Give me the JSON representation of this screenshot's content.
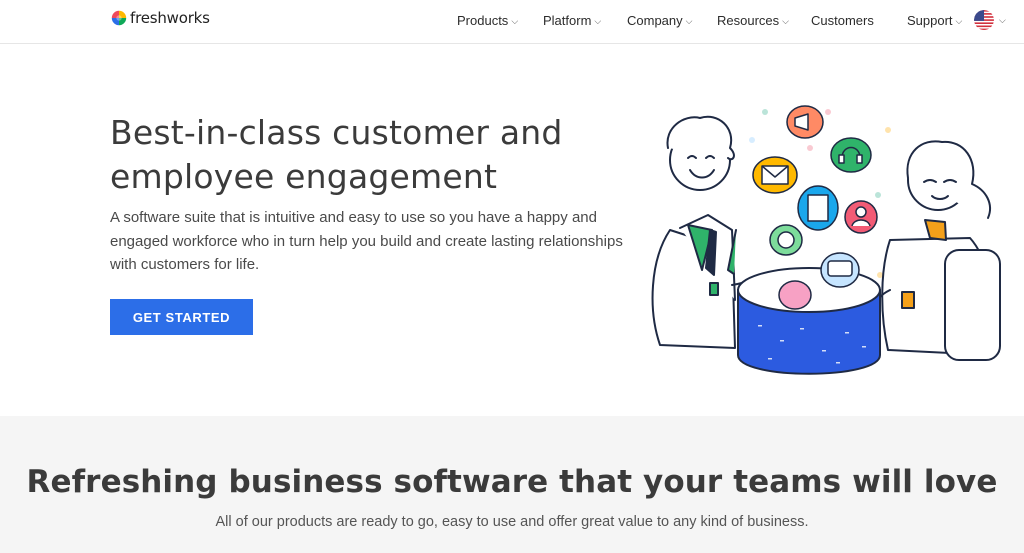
{
  "header": {
    "logo_text": "freshworks",
    "nav": [
      {
        "label": "Products",
        "has_dropdown": true
      },
      {
        "label": "Platform",
        "has_dropdown": true
      },
      {
        "label": "Company",
        "has_dropdown": true
      },
      {
        "label": "Resources",
        "has_dropdown": true
      },
      {
        "label": "Customers",
        "has_dropdown": false
      },
      {
        "label": "Support",
        "has_dropdown": true
      }
    ],
    "locale_icon": "us-flag-icon"
  },
  "hero": {
    "title": "Best-in-class customer and employee engagement",
    "subtitle": "A software suite that is intuitive and easy to use so you have a happy and engaged workforce who in turn help you build and create lasting relationships with customers for life.",
    "cta_label": "GET STARTED"
  },
  "section": {
    "title": "Refreshing business software that your teams will love",
    "subtitle": "All of our products are ready to go, easy to use and offer great value to any kind of business."
  },
  "colors": {
    "primary": "#2c6ee8",
    "band_bg": "#f5f5f5",
    "text_dark": "#3b3b3b"
  }
}
